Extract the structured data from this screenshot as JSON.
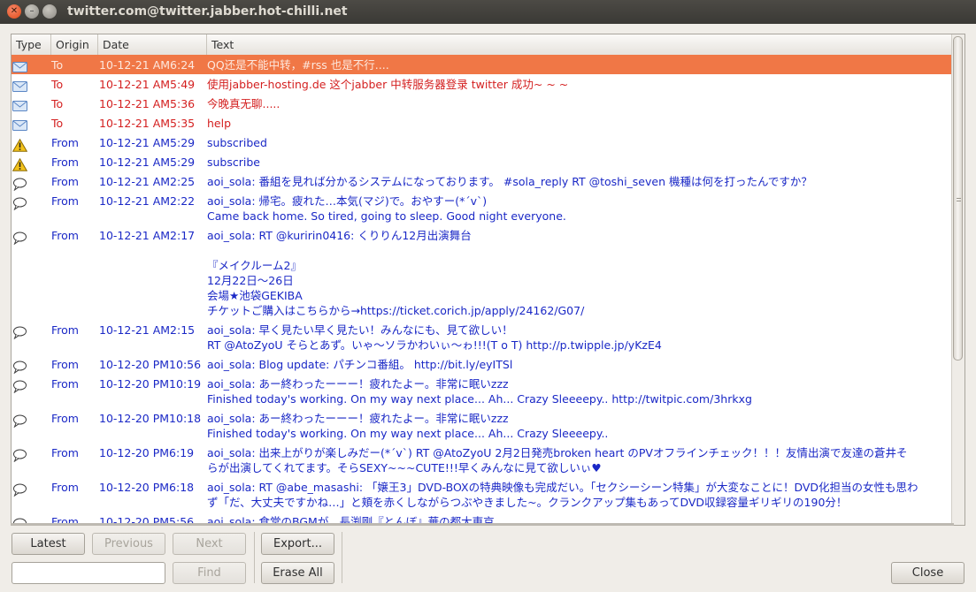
{
  "window": {
    "title": "twitter.com@twitter.jabber.hot-chilli.net"
  },
  "columns": [
    "Type",
    "Origin",
    "Date",
    "Text"
  ],
  "rows": [
    {
      "type": "mail",
      "origin": "To",
      "date": "10-12-21 AM6:24",
      "text": "QQ还是不能中转，#rss 也是不行....",
      "selected": true
    },
    {
      "type": "mail",
      "origin": "To",
      "date": "10-12-21 AM5:49",
      "text": "使用jabber-hosting.de 这个jabber 中转服务器登录 twitter 成功~ ~ ~"
    },
    {
      "type": "mail",
      "origin": "To",
      "date": "10-12-21 AM5:36",
      "text": "今晚真无聊....."
    },
    {
      "type": "mail",
      "origin": "To",
      "date": "10-12-21 AM5:35",
      "text": "help"
    },
    {
      "type": "warning",
      "origin": "From",
      "date": "10-12-21 AM5:29",
      "text": "subscribed"
    },
    {
      "type": "warning",
      "origin": "From",
      "date": "10-12-21 AM5:29",
      "text": "subscribe"
    },
    {
      "type": "chat",
      "origin": "From",
      "date": "10-12-21 AM2:25",
      "text": "aoi_sola: 番組を見れば分かるシステムになっております。 #sola_reply RT @toshi_seven 機種は何を打ったんですか？"
    },
    {
      "type": "chat",
      "origin": "From",
      "date": "10-12-21 AM2:22",
      "text": "aoi_sola: 帰宅。疲れた…本気(マジ)で。おやすー(*´v`)\nCame back home. So tired, going to sleep. Good night everyone."
    },
    {
      "type": "chat",
      "origin": "From",
      "date": "10-12-21 AM2:17",
      "text": "aoi_sola: RT @kuririn0416: くりりん12月出演舞台\n\n『メイクルーム2』\n12月22日〜26日\n会場★池袋GEKIBA\nチケットご購入はこちらから→https://ticket.corich.jp/apply/24162/G07/"
    },
    {
      "type": "chat",
      "origin": "From",
      "date": "10-12-21 AM2:15",
      "text": "aoi_sola: 早く見たい早く見たい！みんなにも、見て欲しい！\nRT @AtoZyoU そらとあず。いゃ〜ソラかわいぃ〜ゎ!!!(T o T) http://p.twipple.jp/yKzE4"
    },
    {
      "type": "chat",
      "origin": "From",
      "date": "10-12-20 PM10:56",
      "text": "aoi_sola: Blog update: パチンコ番組。 http://bit.ly/eyITSl"
    },
    {
      "type": "chat",
      "origin": "From",
      "date": "10-12-20 PM10:19",
      "text": "aoi_sola: あー終わったーーー！疲れたよー。非常に眠いzzz\nFinished today's working. On my way next place... Ah... Crazy Sleeeepy.. http://twitpic.com/3hrkxg"
    },
    {
      "type": "chat",
      "origin": "From",
      "date": "10-12-20 PM10:18",
      "text": "aoi_sola: あー終わったーーー！疲れたよー。非常に眠いzzz\nFinished today's working. On my way next place... Ah... Crazy Sleeeepy.."
    },
    {
      "type": "chat",
      "origin": "From",
      "date": "10-12-20 PM6:19",
      "text": "aoi_sola: 出来上がりが楽しみだー(*´v`) RT @AtoZyoU 2月2日発売broken heart のPVオフラインチェック！！！友情出演で友達の蒼井そ\nらが出演してくれてます。そらSEXY~~~CUTE!!!早くみんなに見て欲しいぃ♥"
    },
    {
      "type": "chat",
      "origin": "From",
      "date": "10-12-20 PM6:18",
      "text": "aoi_sola: RT @abe_masashi: 「嬢王3」DVD-BOXの特典映像も完成だい。「セクシーシーン特集」が大変なことに！DVD化担当の女性も思わ\nず「だ、大丈夫ですかね…」と頬を赤くしながらつぶやきました~。クランクアップ集もあってDVD収録容量ギリギリの190分！"
    },
    {
      "type": "chat",
      "origin": "From",
      "date": "10-12-20 PM5:56",
      "text": "aoi_sola: 食堂のBGMが、長渕剛『とんぼ』華の都大東京。\n懐かしい、小学生？幼稚園？渋い歌が歌えてたんだ私w"
    }
  ],
  "buttons": {
    "latest": "Latest",
    "previous": "Previous",
    "next": "Next",
    "export": "Export...",
    "find": "Find",
    "erase_all": "Erase All",
    "close": "Close"
  },
  "search": {
    "value": ""
  },
  "colors": {
    "selection": "#f07746",
    "outgoing_text": "#d42020",
    "incoming_text": "#1a28c6"
  }
}
